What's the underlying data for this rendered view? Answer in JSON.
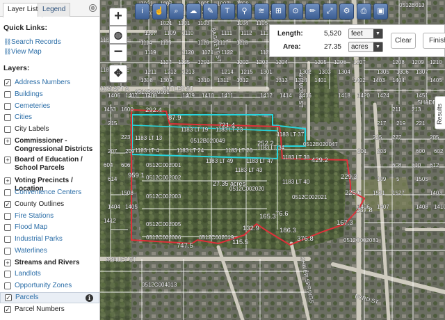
{
  "panel": {
    "tabs": [
      {
        "label": "Layer List",
        "active": true
      },
      {
        "label": "Legend",
        "active": false
      }
    ],
    "close_icon": "⊗",
    "quick_links_title": "Quick Links:",
    "quick_links": [
      {
        "label": "Search Records",
        "icon": "link-icon"
      },
      {
        "label": "View Map",
        "icon": "link-icon"
      }
    ],
    "layers_title": "Layers:",
    "layers": [
      {
        "label": "Address Numbers",
        "checked": true,
        "expandable": false,
        "style": "link"
      },
      {
        "label": "Buildings",
        "checked": false,
        "expandable": false,
        "style": "link"
      },
      {
        "label": "Cemeteries",
        "checked": false,
        "expandable": false,
        "style": "link"
      },
      {
        "label": "Cities",
        "checked": false,
        "expandable": false,
        "style": "link"
      },
      {
        "label": "City Labels",
        "checked": false,
        "expandable": false,
        "style": "plain"
      },
      {
        "label": "Commissioner - Congressional Districts",
        "checked": false,
        "expandable": true,
        "style": "bold"
      },
      {
        "label": "Board of Education / School Parcels",
        "checked": false,
        "expandable": true,
        "style": "bold"
      },
      {
        "label": "Voting Precincts / Location",
        "checked": false,
        "expandable": true,
        "style": "bold"
      },
      {
        "label": "Convenience Centers",
        "checked": false,
        "expandable": false,
        "style": "link"
      },
      {
        "label": "County Outlines",
        "checked": true,
        "expandable": false,
        "style": "plain"
      },
      {
        "label": "Fire Stations",
        "checked": false,
        "expandable": false,
        "style": "link"
      },
      {
        "label": "Flood Map",
        "checked": false,
        "expandable": false,
        "style": "link"
      },
      {
        "label": "Industrial Parks",
        "checked": false,
        "expandable": false,
        "style": "link"
      },
      {
        "label": "Waterlines",
        "checked": false,
        "expandable": false,
        "style": "link"
      },
      {
        "label": "Streams and Rivers",
        "checked": false,
        "expandable": true,
        "style": "bold"
      },
      {
        "label": "Landlots",
        "checked": false,
        "expandable": false,
        "style": "link"
      },
      {
        "label": "Opportunity Zones",
        "checked": false,
        "expandable": false,
        "style": "link"
      },
      {
        "label": "Parcels",
        "checked": true,
        "expandable": false,
        "style": "link",
        "highlight": true,
        "info": "i"
      },
      {
        "label": "Parcel Numbers",
        "checked": true,
        "expandable": false,
        "style": "plain"
      }
    ]
  },
  "map_controls": {
    "zoom_in": "+",
    "globe": "◍",
    "zoom_out": "−",
    "pan": "✥"
  },
  "toolbar": [
    {
      "name": "info-tool-icon",
      "glyph": "i"
    },
    {
      "name": "identify-tool-icon",
      "glyph": "☝"
    },
    {
      "name": "search-tool-icon",
      "glyph": "⌕"
    },
    {
      "name": "cloud-tool-icon",
      "glyph": "☁"
    },
    {
      "name": "eraser-tool-icon",
      "glyph": "✎"
    },
    {
      "name": "text-tool-icon",
      "glyph": "T"
    },
    {
      "name": "marker-tool-icon",
      "glyph": "⚲"
    },
    {
      "name": "layers-tool-icon",
      "glyph": "≋"
    },
    {
      "name": "measure-tool-icon",
      "glyph": "⊞"
    },
    {
      "name": "zoom-select-tool-icon",
      "glyph": "⊙"
    },
    {
      "name": "draw-tool-icon",
      "glyph": "✏"
    },
    {
      "name": "extent-tool-icon",
      "glyph": "⤢"
    },
    {
      "name": "tools-tool-icon",
      "glyph": "⚙"
    },
    {
      "name": "print-tool-icon",
      "glyph": "⎙"
    },
    {
      "name": "save-tool-icon",
      "glyph": "▣"
    }
  ],
  "measure": {
    "length_label": "Length:",
    "length_value": "5,520",
    "length_unit": "feet",
    "area_label": "Area:",
    "area_value": "27.35",
    "area_unit": "acres",
    "clear_label": "Clear",
    "finish_label": "Finish"
  },
  "results_tab": "Results",
  "colors": {
    "panel_link": "#2a6da7",
    "toolbar_blue": "#3c5e93",
    "measure_red": "#e0303a",
    "selection_cyan": "#27d6e0",
    "parcel_line": "#ffffff"
  },
  "map": {
    "street_labels": [
      "BUTLER ST",
      "SIMMONS ST",
      "ASHLEY ST",
      "BYRD ST",
      "SHADE ST",
      "SHIVER SPRINGS",
      "BAGGETT ST"
    ],
    "parcel_ids": [
      "0512B013",
      "0512B020001",
      "0512B020049",
      "0512B020047",
      "0512C002001",
      "0512C002002",
      "0512C002003",
      "0512C002005",
      "0512C002006",
      "0512C002019",
      "0512C002020",
      "0512C002021",
      "0512C002081",
      "0512C004013"
    ],
    "lot_labels": [
      "1183 LT 19",
      "1183 LT 23",
      "1183 LT 37",
      "1183 LT 13",
      "1183 LT 4",
      "1183 LT 24",
      "1183 LT 26",
      "1183 LT 49",
      "1183 LT 47",
      "1183 LT 38",
      "1183 LT 43",
      "1183 LT 40",
      "1183 LT 34",
      "1183 APT C",
      "1183 APT E",
      "1183 APT A"
    ],
    "segment_labels": [
      "292.4",
      "87.9",
      "721.4",
      "252.2",
      "429.2",
      "229.3",
      "225.6",
      "237.8",
      "167.3",
      "376.8",
      "186.3",
      "76.6",
      "165.3",
      "132.9",
      "115.5",
      "747.5",
      "959.1"
    ],
    "area_label": "27.35 acres",
    "address_numbers": [
      "1001",
      "1003",
      "1005",
      "1007",
      "1008",
      "1011",
      "1013",
      "1015",
      "1017",
      "1019",
      "1021",
      "1101",
      "1103",
      "1104",
      "1105",
      "1107",
      "1109",
      "1110",
      "1111",
      "1112",
      "1113",
      "1114",
      "1115",
      "1116",
      "1117",
      "1118",
      "1119",
      "1120",
      "1121",
      "1122",
      "1123",
      "1124",
      "1125",
      "1201",
      "1202",
      "1203",
      "1204",
      "1205",
      "1206",
      "1207",
      "1208",
      "1209",
      "1210",
      "1211",
      "1212",
      "1213",
      "1214",
      "1215",
      "1301",
      "1302",
      "1303",
      "1304",
      "1305",
      "1306",
      "1307",
      "1308",
      "1309",
      "1310",
      "1311",
      "1312",
      "1313",
      "1314",
      "1401",
      "1402",
      "1403",
      "1404",
      "1405",
      "1406",
      "1407",
      "1408",
      "1409",
      "1410",
      "1411",
      "1412",
      "1414",
      "1416",
      "1418",
      "1420",
      "1424",
      "1451",
      "1453",
      "1600",
      "211",
      "213",
      "215",
      "217",
      "219",
      "221",
      "223",
      "225",
      "227",
      "205",
      "207",
      "209",
      "201",
      "203",
      "600",
      "602",
      "604",
      "606",
      "608",
      "610",
      "612",
      "614",
      "109",
      "5",
      "1505",
      "1508",
      "1521",
      "1527",
      "1403",
      "1404",
      "1405",
      "1406",
      "1407",
      "1408",
      "1410",
      "1412"
    ]
  }
}
